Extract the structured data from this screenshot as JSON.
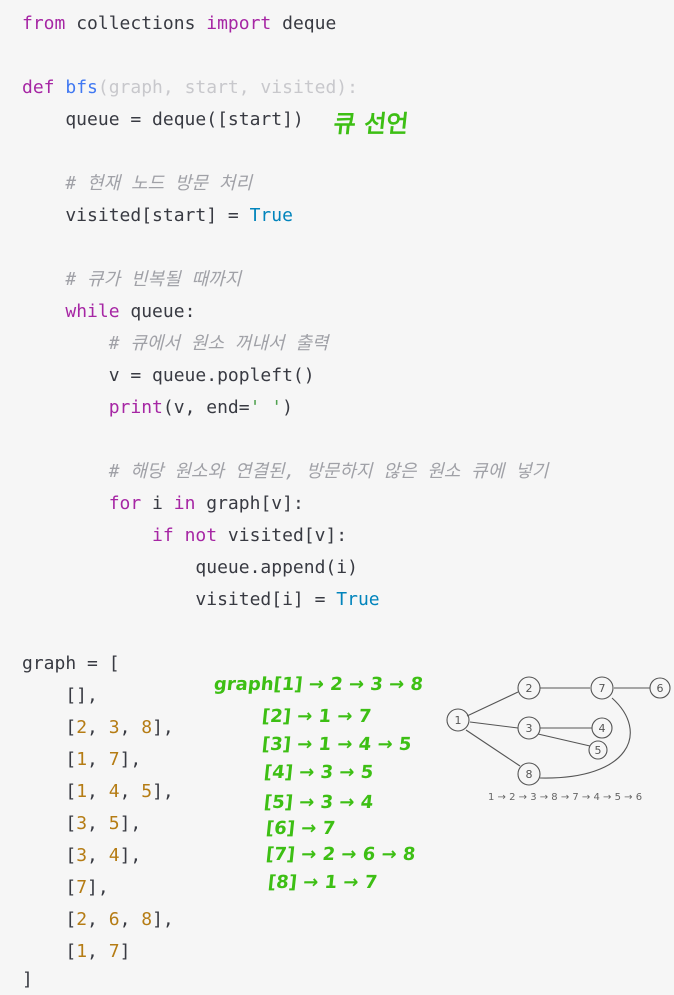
{
  "code": {
    "l1": {
      "a": "from",
      "b": " collections ",
      "c": "import",
      "d": " deque"
    },
    "l2": {
      "a": "def",
      "b": " ",
      "c": "bfs",
      "d": "(graph, start, visited):"
    },
    "l3": {
      "a": "    queue = deque([start])"
    },
    "l4": {
      "a": "    # 현재 노드 방문 처리"
    },
    "l5": {
      "a": "    visited[start] = ",
      "b": "True"
    },
    "l6": {
      "a": "    # 큐가 빈복될 때까지"
    },
    "l7": {
      "a": "    ",
      "b": "while",
      "c": " queue:"
    },
    "l8": {
      "a": "        # 큐에서 원소 꺼내서 출력"
    },
    "l9": {
      "a": "        v = queue.popleft()"
    },
    "l10": {
      "a": "        ",
      "b": "print",
      "c": "(v, end=",
      "d": "' '",
      "e": ")"
    },
    "l11": {
      "a": "        # 해당 원소와 연결된, 방문하지 않은 원소 큐에 넣기"
    },
    "l12": {
      "a": "        ",
      "b": "for",
      "c": " i ",
      "d": "in",
      "e": " graph[v]:"
    },
    "l13": {
      "a": "            ",
      "b": "if",
      "c": " ",
      "d": "not",
      "e": " visited[v]:"
    },
    "l14": {
      "a": "                queue.append(i)"
    },
    "l15": {
      "a": "                visited[i] = ",
      "b": "True"
    },
    "l16": {
      "a": "graph = ["
    },
    "g": [
      {
        "o": "    [],"
      },
      {
        "o": "    [",
        "n1": "2",
        ",": ", ",
        "n2": "3",
        "n3": "8",
        "c": "],"
      },
      {
        "o": "    [",
        "n1": "1",
        "n2": "7",
        "c": "],"
      },
      {
        "o": "    [",
        "n1": "1",
        "n2": "4",
        "n3": "5",
        "c": "],"
      },
      {
        "o": "    [",
        "n1": "3",
        "n2": "5",
        "c": "],"
      },
      {
        "o": "    [",
        "n1": "3",
        "n2": "4",
        "c": "],"
      },
      {
        "o": "    [",
        "n1": "7",
        "c": "],"
      },
      {
        "o": "    [",
        "n1": "2",
        "n2": "6",
        "n3": "8",
        "c": "],"
      },
      {
        "o": "    [",
        "n1": "1",
        "n2": "7",
        "c": "]"
      }
    ],
    "sep": ", ",
    "l26": {
      "a": "]"
    }
  },
  "handwriting": {
    "queue_note": "큐 선언",
    "adjacency": [
      "graph[1] → 2 → 3 → 8",
      "[2] → 1 → 7",
      "[3] → 1 → 4 → 5",
      "[4] → 3 → 5",
      "[5] → 3 → 4",
      "[6] → 7",
      "[7] → 2 → 6 → 8",
      "[8] → 1 → 7"
    ],
    "nodes": [
      "1",
      "2",
      "3",
      "4",
      "5",
      "6",
      "7",
      "8"
    ],
    "bfs_order": "1 → 2 → 3 → 8 → 7 → 4 → 5 → 6"
  },
  "colors": {
    "keyword": "#a626a4",
    "function": "#4078f2",
    "builtin": "#0184bc",
    "comment": "#a0a1a7",
    "string": "#50a14f",
    "number": "#b57c14",
    "handwriting": "#3dbf14"
  }
}
